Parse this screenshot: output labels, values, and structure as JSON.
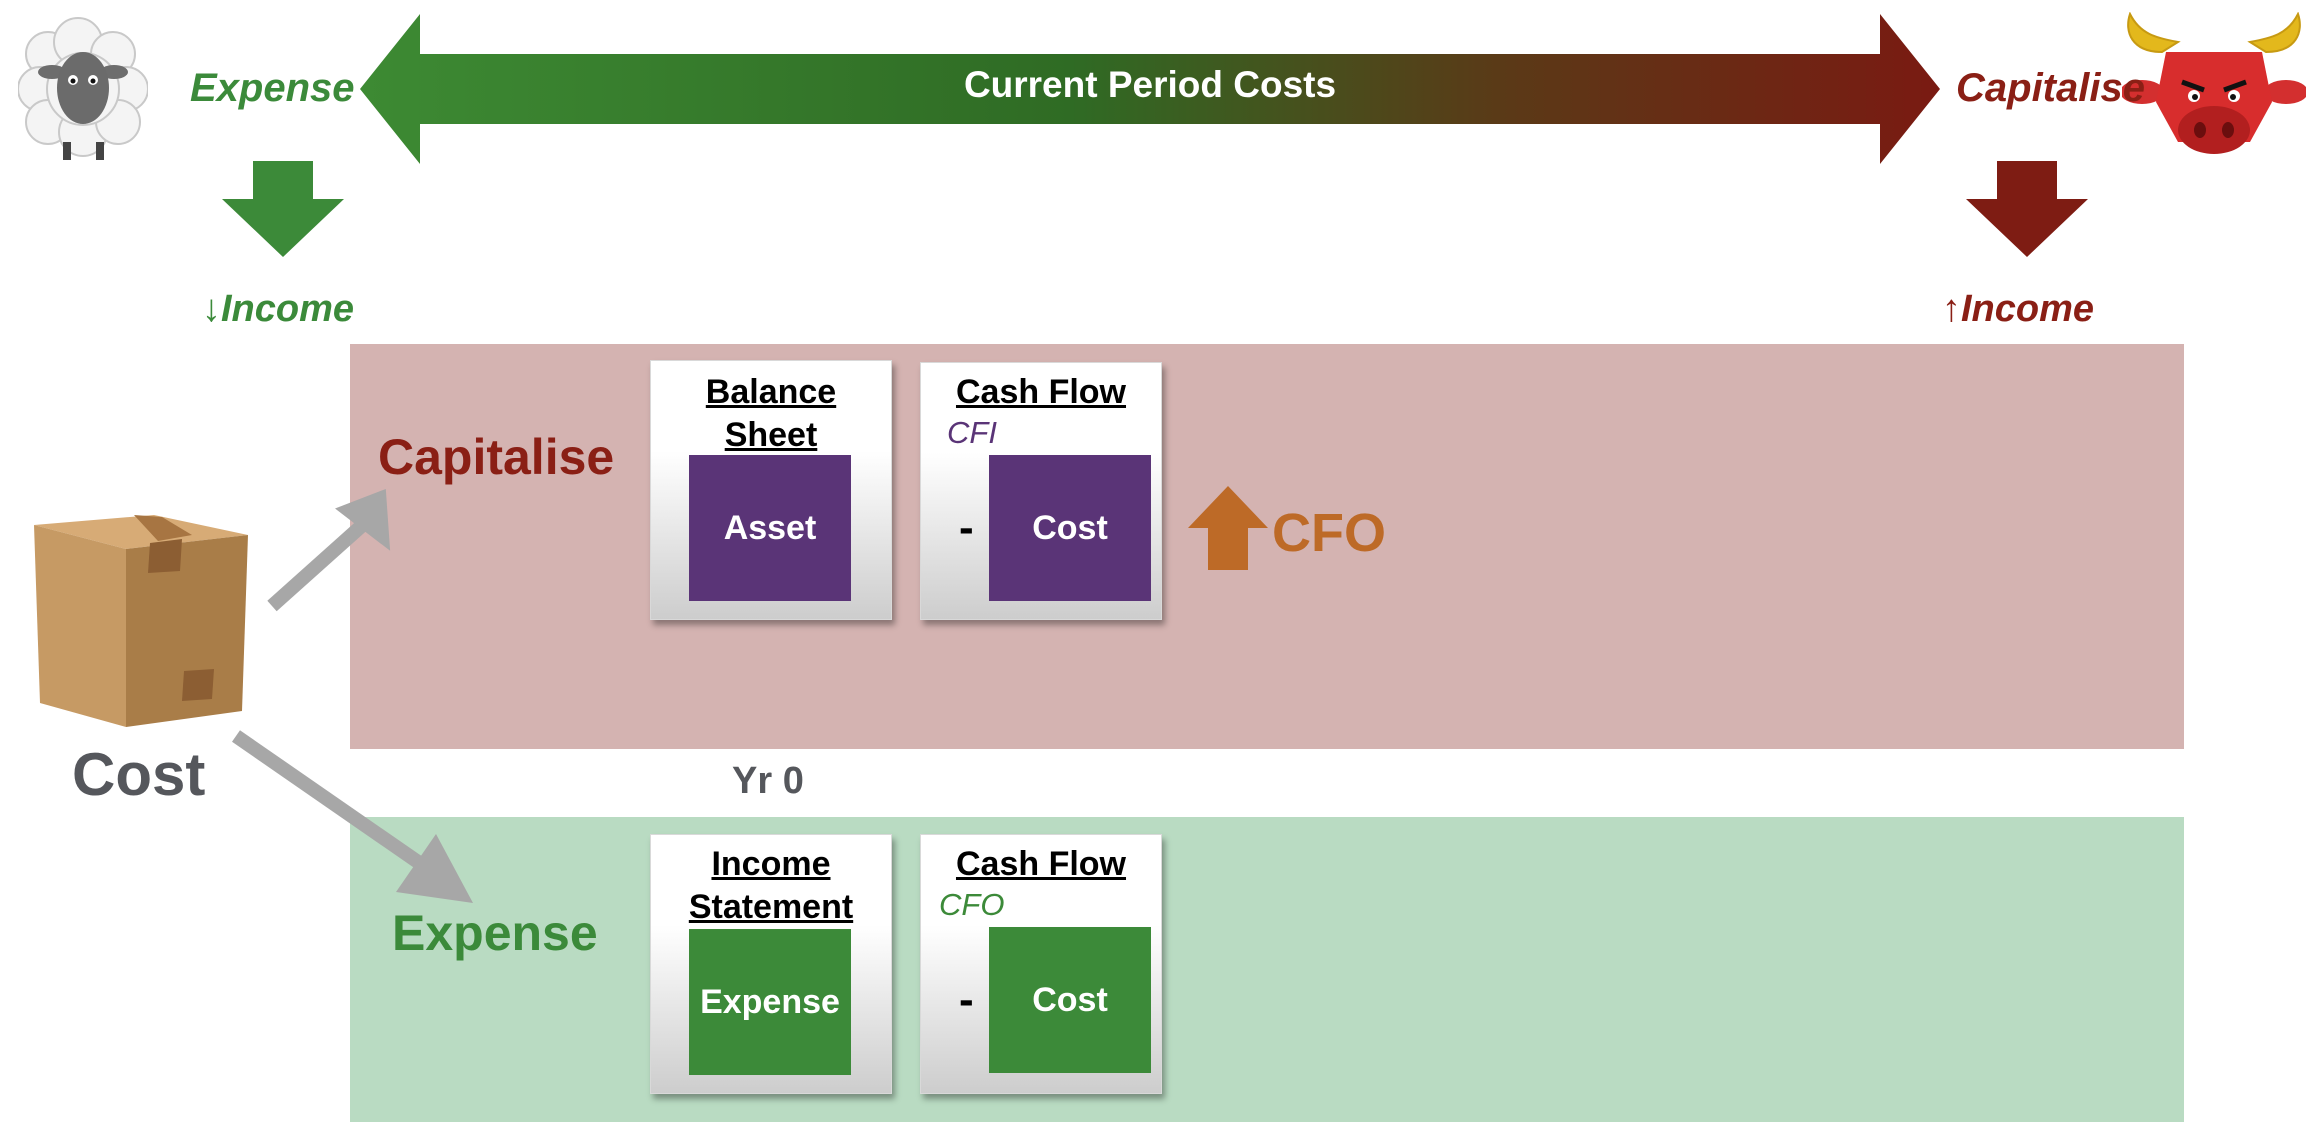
{
  "top_bar": {
    "label": "Current Period Costs",
    "left_label": "Expense",
    "right_label": "Capitalise",
    "left_income": "↓Income",
    "right_income": "↑Income"
  },
  "source": {
    "label": "Cost"
  },
  "capitalise_path": {
    "label": "Capitalise",
    "balance_sheet": {
      "title_line1": "Balance",
      "title_line2": "Sheet",
      "box": "Asset"
    },
    "cash_flow": {
      "title": "Cash Flow",
      "sub": "CFI",
      "minus": "-",
      "box": "Cost"
    },
    "effect_label": "CFO"
  },
  "year_label": "Yr 0",
  "expense_path": {
    "label": "Expense",
    "income_statement": {
      "title_line1": "Income",
      "title_line2": "Statement",
      "box": "Expense"
    },
    "cash_flow": {
      "title": "Cash Flow",
      "sub": "CFO",
      "minus": "-",
      "box": "Cost"
    }
  },
  "colors": {
    "green": "#3b8a3a",
    "dark_red": "#8a1f15",
    "purple": "#5a3477",
    "orange": "#bd6a27",
    "capitalise_band": "#d4b3b1",
    "expense_band": "#b9dbc2"
  }
}
